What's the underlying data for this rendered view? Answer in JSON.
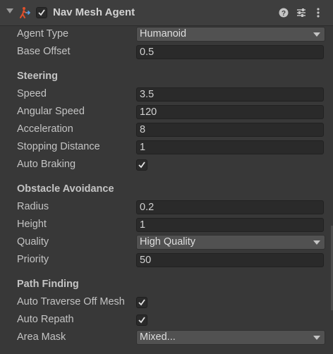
{
  "header": {
    "title": "Nav Mesh Agent",
    "enabled": true,
    "icons": [
      "nav-mesh-agent-icon",
      "help-icon",
      "preset-icon",
      "more-options-icon"
    ]
  },
  "fields": {
    "agent_type": {
      "label": "Agent Type",
      "value": "Humanoid"
    },
    "base_offset": {
      "label": "Base Offset",
      "value": "0.5"
    }
  },
  "steering": {
    "title": "Steering",
    "speed": {
      "label": "Speed",
      "value": "3.5"
    },
    "angular_speed": {
      "label": "Angular Speed",
      "value": "120"
    },
    "acceleration": {
      "label": "Acceleration",
      "value": "8"
    },
    "stopping_distance": {
      "label": "Stopping Distance",
      "value": "1"
    },
    "auto_braking": {
      "label": "Auto Braking",
      "checked": true
    }
  },
  "obstacle_avoidance": {
    "title": "Obstacle Avoidance",
    "radius": {
      "label": "Radius",
      "value": "0.2"
    },
    "height": {
      "label": "Height",
      "value": "1"
    },
    "quality": {
      "label": "Quality",
      "value": "High Quality"
    },
    "priority": {
      "label": "Priority",
      "value": "50"
    }
  },
  "path_finding": {
    "title": "Path Finding",
    "auto_traverse": {
      "label": "Auto Traverse Off Mesh",
      "checked": true
    },
    "auto_repath": {
      "label": "Auto Repath",
      "checked": true
    },
    "area_mask": {
      "label": "Area Mask",
      "value": "Mixed..."
    }
  },
  "colors": {
    "background": "#383838",
    "field": "#2a2a2a",
    "dropdown": "#515151",
    "icon_accent": "#e0502c"
  }
}
